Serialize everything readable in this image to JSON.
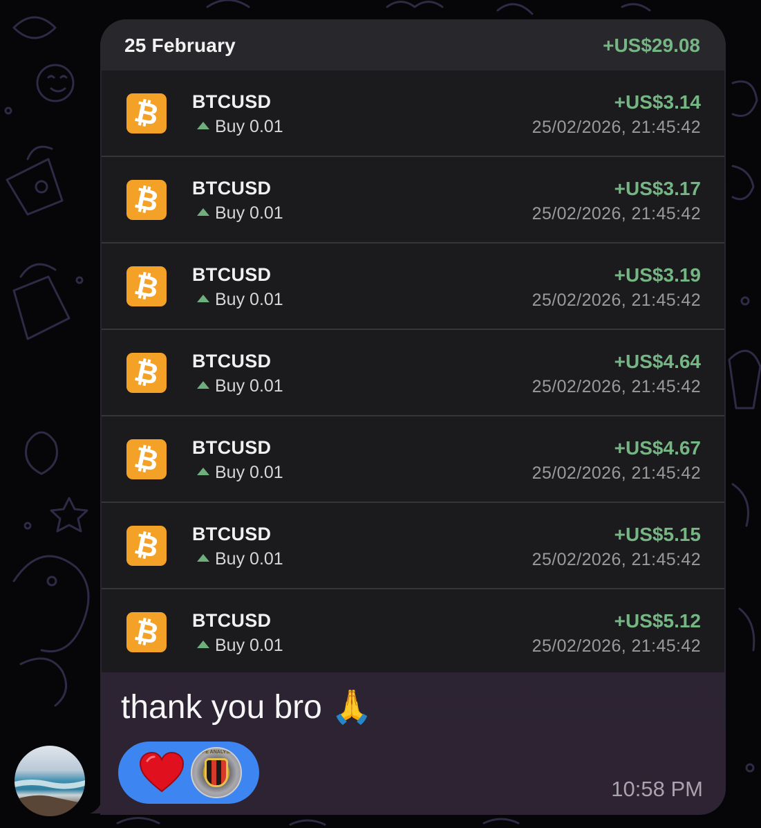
{
  "card": {
    "date": "25 February",
    "total": "+US$29.08"
  },
  "trades": [
    {
      "symbol": "BTCUSD",
      "side": "Buy",
      "volume": "0.01",
      "profit": "+US$3.14",
      "time": "25/02/2026, 21:45:42"
    },
    {
      "symbol": "BTCUSD",
      "side": "Buy",
      "volume": "0.01",
      "profit": "+US$3.17",
      "time": "25/02/2026, 21:45:42"
    },
    {
      "symbol": "BTCUSD",
      "side": "Buy",
      "volume": "0.01",
      "profit": "+US$3.19",
      "time": "25/02/2026, 21:45:42"
    },
    {
      "symbol": "BTCUSD",
      "side": "Buy",
      "volume": "0.01",
      "profit": "+US$4.64",
      "time": "25/02/2026, 21:45:42"
    },
    {
      "symbol": "BTCUSD",
      "side": "Buy",
      "volume": "0.01",
      "profit": "+US$4.67",
      "time": "25/02/2026, 21:45:42"
    },
    {
      "symbol": "BTCUSD",
      "side": "Buy",
      "volume": "0.01",
      "profit": "+US$5.15",
      "time": "25/02/2026, 21:45:42"
    },
    {
      "symbol": "BTCUSD",
      "side": "Buy",
      "volume": "0.01",
      "profit": "+US$5.12",
      "time": "25/02/2026, 21:45:42"
    }
  ],
  "message": {
    "text": "thank you bro 🙏",
    "time": "10:58 PM",
    "reactions": [
      {
        "icon": "red-heart-icon"
      },
      {
        "icon": "reactor-avatar",
        "badge_text": "APE ANALYSIS"
      }
    ]
  },
  "coin_glyph": "₿",
  "colors": {
    "profit": "#76b685",
    "coin": "#f3a127",
    "reaction_pill": "#3d86f2",
    "card_row": "#1b1b1d"
  }
}
